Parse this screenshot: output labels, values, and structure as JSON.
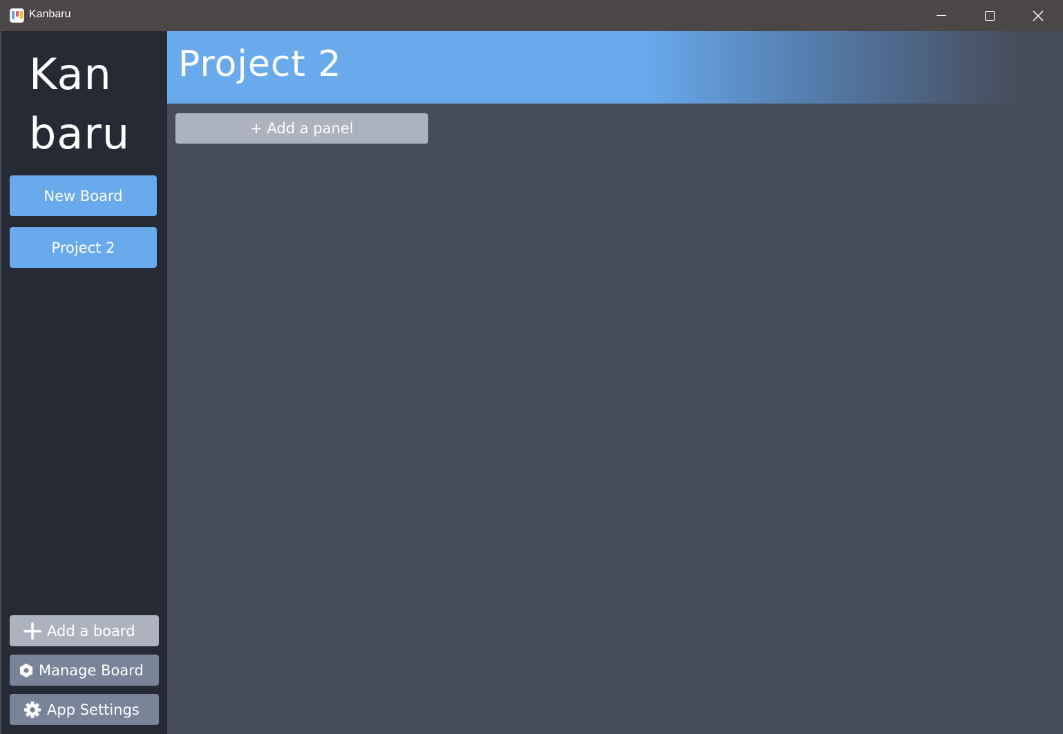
{
  "window": {
    "title": "Kanbaru",
    "icon": "kanbaru-app-icon"
  },
  "sidebar": {
    "logo_line1": "Kan",
    "logo_line2": "baru",
    "boards": [
      {
        "label": "New Board"
      },
      {
        "label": "Project 2"
      }
    ],
    "add_board_label": "Add a board",
    "manage_board_label": "Manage Board",
    "app_settings_label": "App Settings"
  },
  "main": {
    "board_title": "Project 2",
    "add_panel_label": "+ Add a panel"
  },
  "colors": {
    "accent": "#69aaec",
    "sidebar_bg": "#252a34",
    "main_bg": "#464c5a",
    "titlebar_bg": "#4a4746",
    "secondary_button": "#adb2bf",
    "tertiary_button": "#7a8499"
  }
}
